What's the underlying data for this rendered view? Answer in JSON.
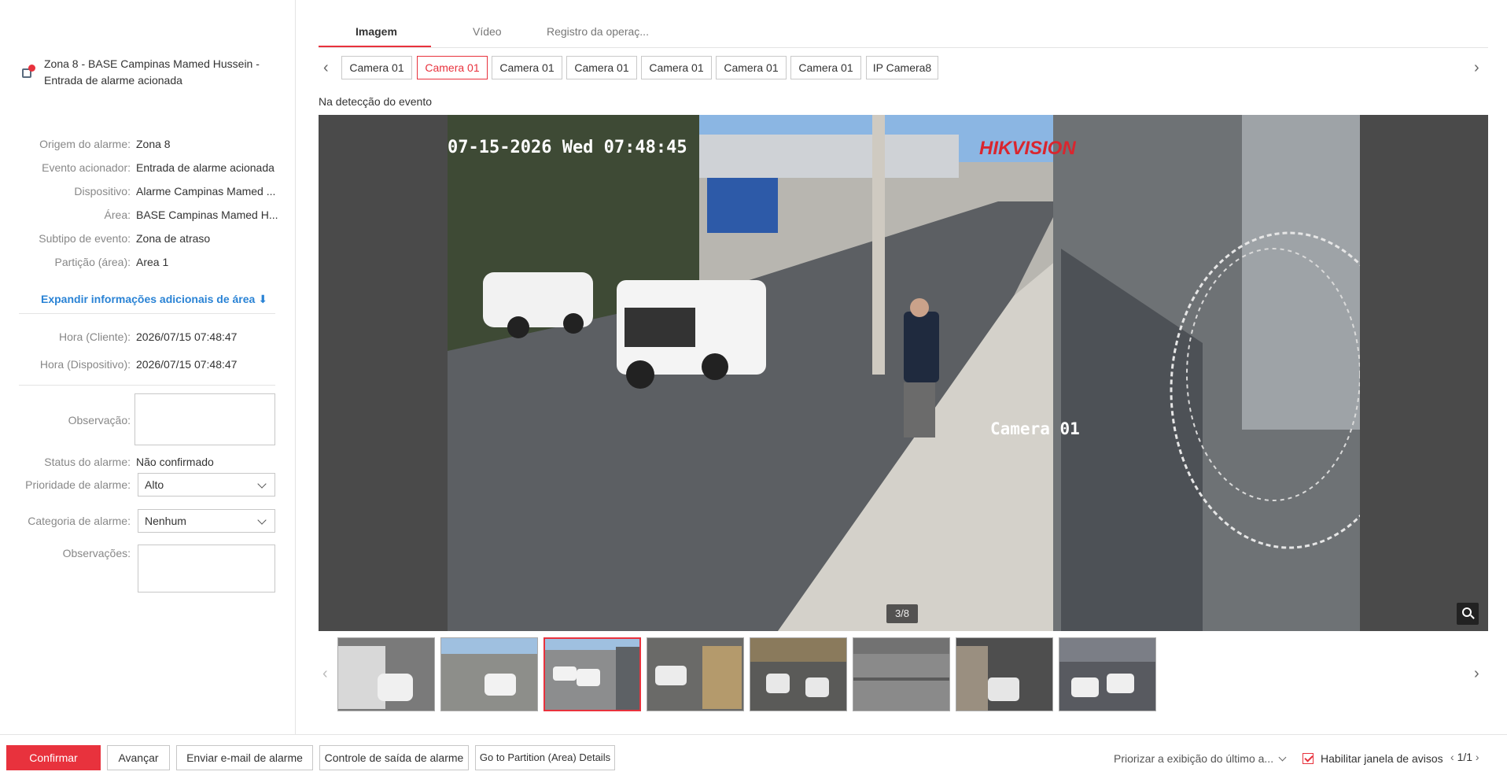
{
  "alarm": {
    "title": "Zona 8 - BASE Campinas Mamed Hussein - Entrada de alarme acionada",
    "details": [
      {
        "label": "Origem do alarme:",
        "value": "Zona 8"
      },
      {
        "label": "Evento acionador:",
        "value": "Entrada de alarme acionada"
      },
      {
        "label": "Dispositivo:",
        "value": "Alarme Campinas Mamed ..."
      },
      {
        "label": "Área:",
        "value": "BASE Campinas Mamed H..."
      },
      {
        "label": "Subtipo de evento:",
        "value": "Zona de atraso"
      },
      {
        "label": "Partição (área):",
        "value": "Area 1"
      }
    ],
    "expand_label": "Expandir informações adicionais de área",
    "time_client_label": "Hora (Cliente):",
    "time_client_value": "2026/07/15 07:48:47",
    "time_device_label": "Hora (Dispositivo):",
    "time_device_value": "2026/07/15 07:48:47",
    "observation_label": "Observação:",
    "status_label": "Status do alarme:",
    "status_value": "Não confirmado",
    "priority_label": "Prioridade de alarme:",
    "priority_value": "Alto",
    "category_label": "Categoria de alarme:",
    "category_value": "Nenhum",
    "notes_label": "Observações:"
  },
  "tabs": [
    {
      "label": "Imagem",
      "active": true
    },
    {
      "label": "Vídeo",
      "active": false
    },
    {
      "label": "Registro da operaç...",
      "active": false
    }
  ],
  "cameras": [
    "Camera 01",
    "Camera 01",
    "Camera 01",
    "Camera 01",
    "Camera 01",
    "Camera 01",
    "Camera 01",
    "IP Camera8"
  ],
  "selected_camera_index": 1,
  "caption": "Na detecção do evento",
  "viewer": {
    "osd_timestamp": "07-15-2026 Wed 07:48:45",
    "osd_brand": "HIKVISION",
    "osd_camera": "Camera 01",
    "counter": "3/8"
  },
  "thumbnails_selected_index": 2,
  "bottom": {
    "confirm": "Confirmar",
    "advance": "Avançar",
    "email": "Enviar e-mail de alarme",
    "output": "Controle de saída de alarme",
    "partition": "Go to Partition (Area) Details",
    "prioritize": "Priorizar a exibição do último a...",
    "enable_popup": "Habilitar janela de avisos",
    "pager": "1/1"
  },
  "colors": {
    "accent": "#e8323d",
    "link": "#2a83d5"
  }
}
